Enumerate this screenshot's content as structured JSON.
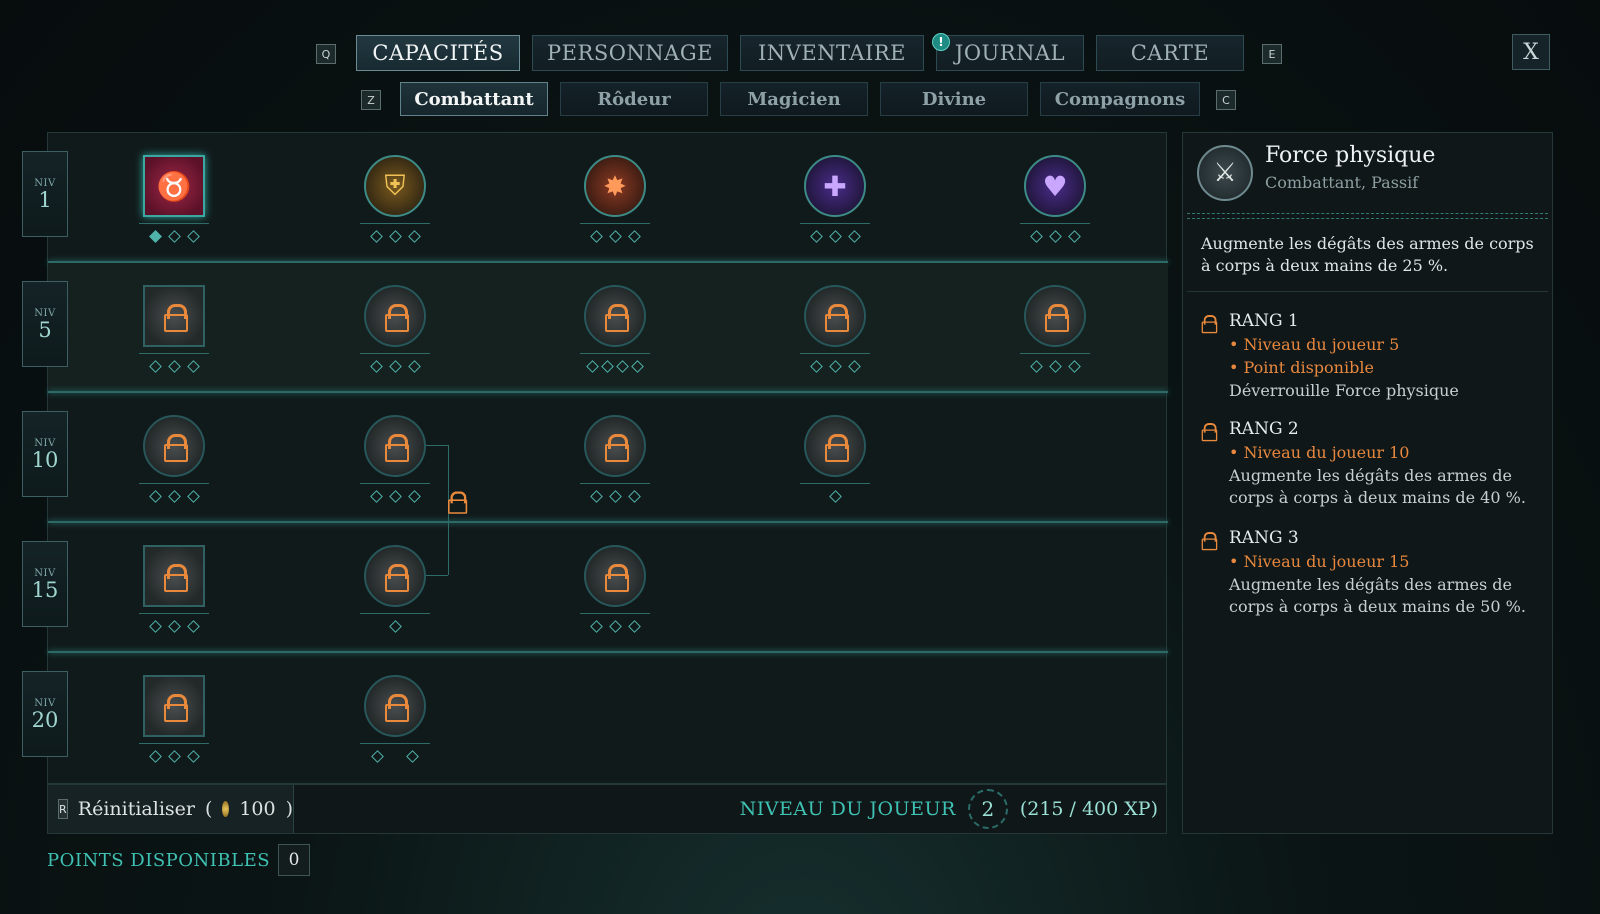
{
  "keys": {
    "prev_tab": "Q",
    "next_tab": "E",
    "prev_subtab": "Z",
    "next_subtab": "C",
    "reset": "R"
  },
  "tabs": [
    {
      "label": "CAPACITÉS",
      "active": true
    },
    {
      "label": "PERSONNAGE",
      "active": false
    },
    {
      "label": "INVENTAIRE",
      "active": false
    },
    {
      "label": "JOURNAL",
      "active": false
    },
    {
      "label": "CARTE",
      "active": false
    }
  ],
  "journal_alert": "!",
  "close_label": "X",
  "subtabs": [
    {
      "label": "Combattant",
      "active": true
    },
    {
      "label": "Rôdeur",
      "active": false
    },
    {
      "label": "Magicien",
      "active": false
    },
    {
      "label": "Divine",
      "active": false
    },
    {
      "label": "Compagnons",
      "active": false
    }
  ],
  "levels": [
    {
      "niv": "NIV",
      "num": "1"
    },
    {
      "niv": "NIV",
      "num": "5"
    },
    {
      "niv": "NIV",
      "num": "10"
    },
    {
      "niv": "NIV",
      "num": "15"
    },
    {
      "niv": "NIV",
      "num": "20"
    }
  ],
  "bottom": {
    "reset_label": "Réinitialiser",
    "reset_cost_open": "(",
    "reset_cost": "100",
    "reset_cost_close": ")",
    "player_level_label": "NIVEAU DU JOUEUR",
    "player_level": "2",
    "xp": "(215 / 400 XP)",
    "points_label": "POINTS DISPONIBLES",
    "points_value": "0"
  },
  "detail": {
    "title": "Force physique",
    "subtitle": "Combattant, Passif",
    "description": "Augmente les dégâts des armes de corps à corps à deux mains de 25 %.",
    "ranks": [
      {
        "title": "RANG 1",
        "reqs": [
          "• Niveau du joueur 5",
          "• Point disponible"
        ],
        "effect": "Déverrouille Force physique"
      },
      {
        "title": "RANG 2",
        "reqs": [
          "• Niveau du joueur 10"
        ],
        "effect": "Augmente les dégâts des armes de corps à corps à deux mains de 40 %."
      },
      {
        "title": "RANG 3",
        "reqs": [
          "• Niveau du joueur 15"
        ],
        "effect": "Augmente les dégâts des armes de corps à corps à deux mains de 50 %."
      }
    ]
  },
  "colors": {
    "accent": "#3fc1b3",
    "requirement": "#e8883e",
    "lock": "#e8893c"
  }
}
